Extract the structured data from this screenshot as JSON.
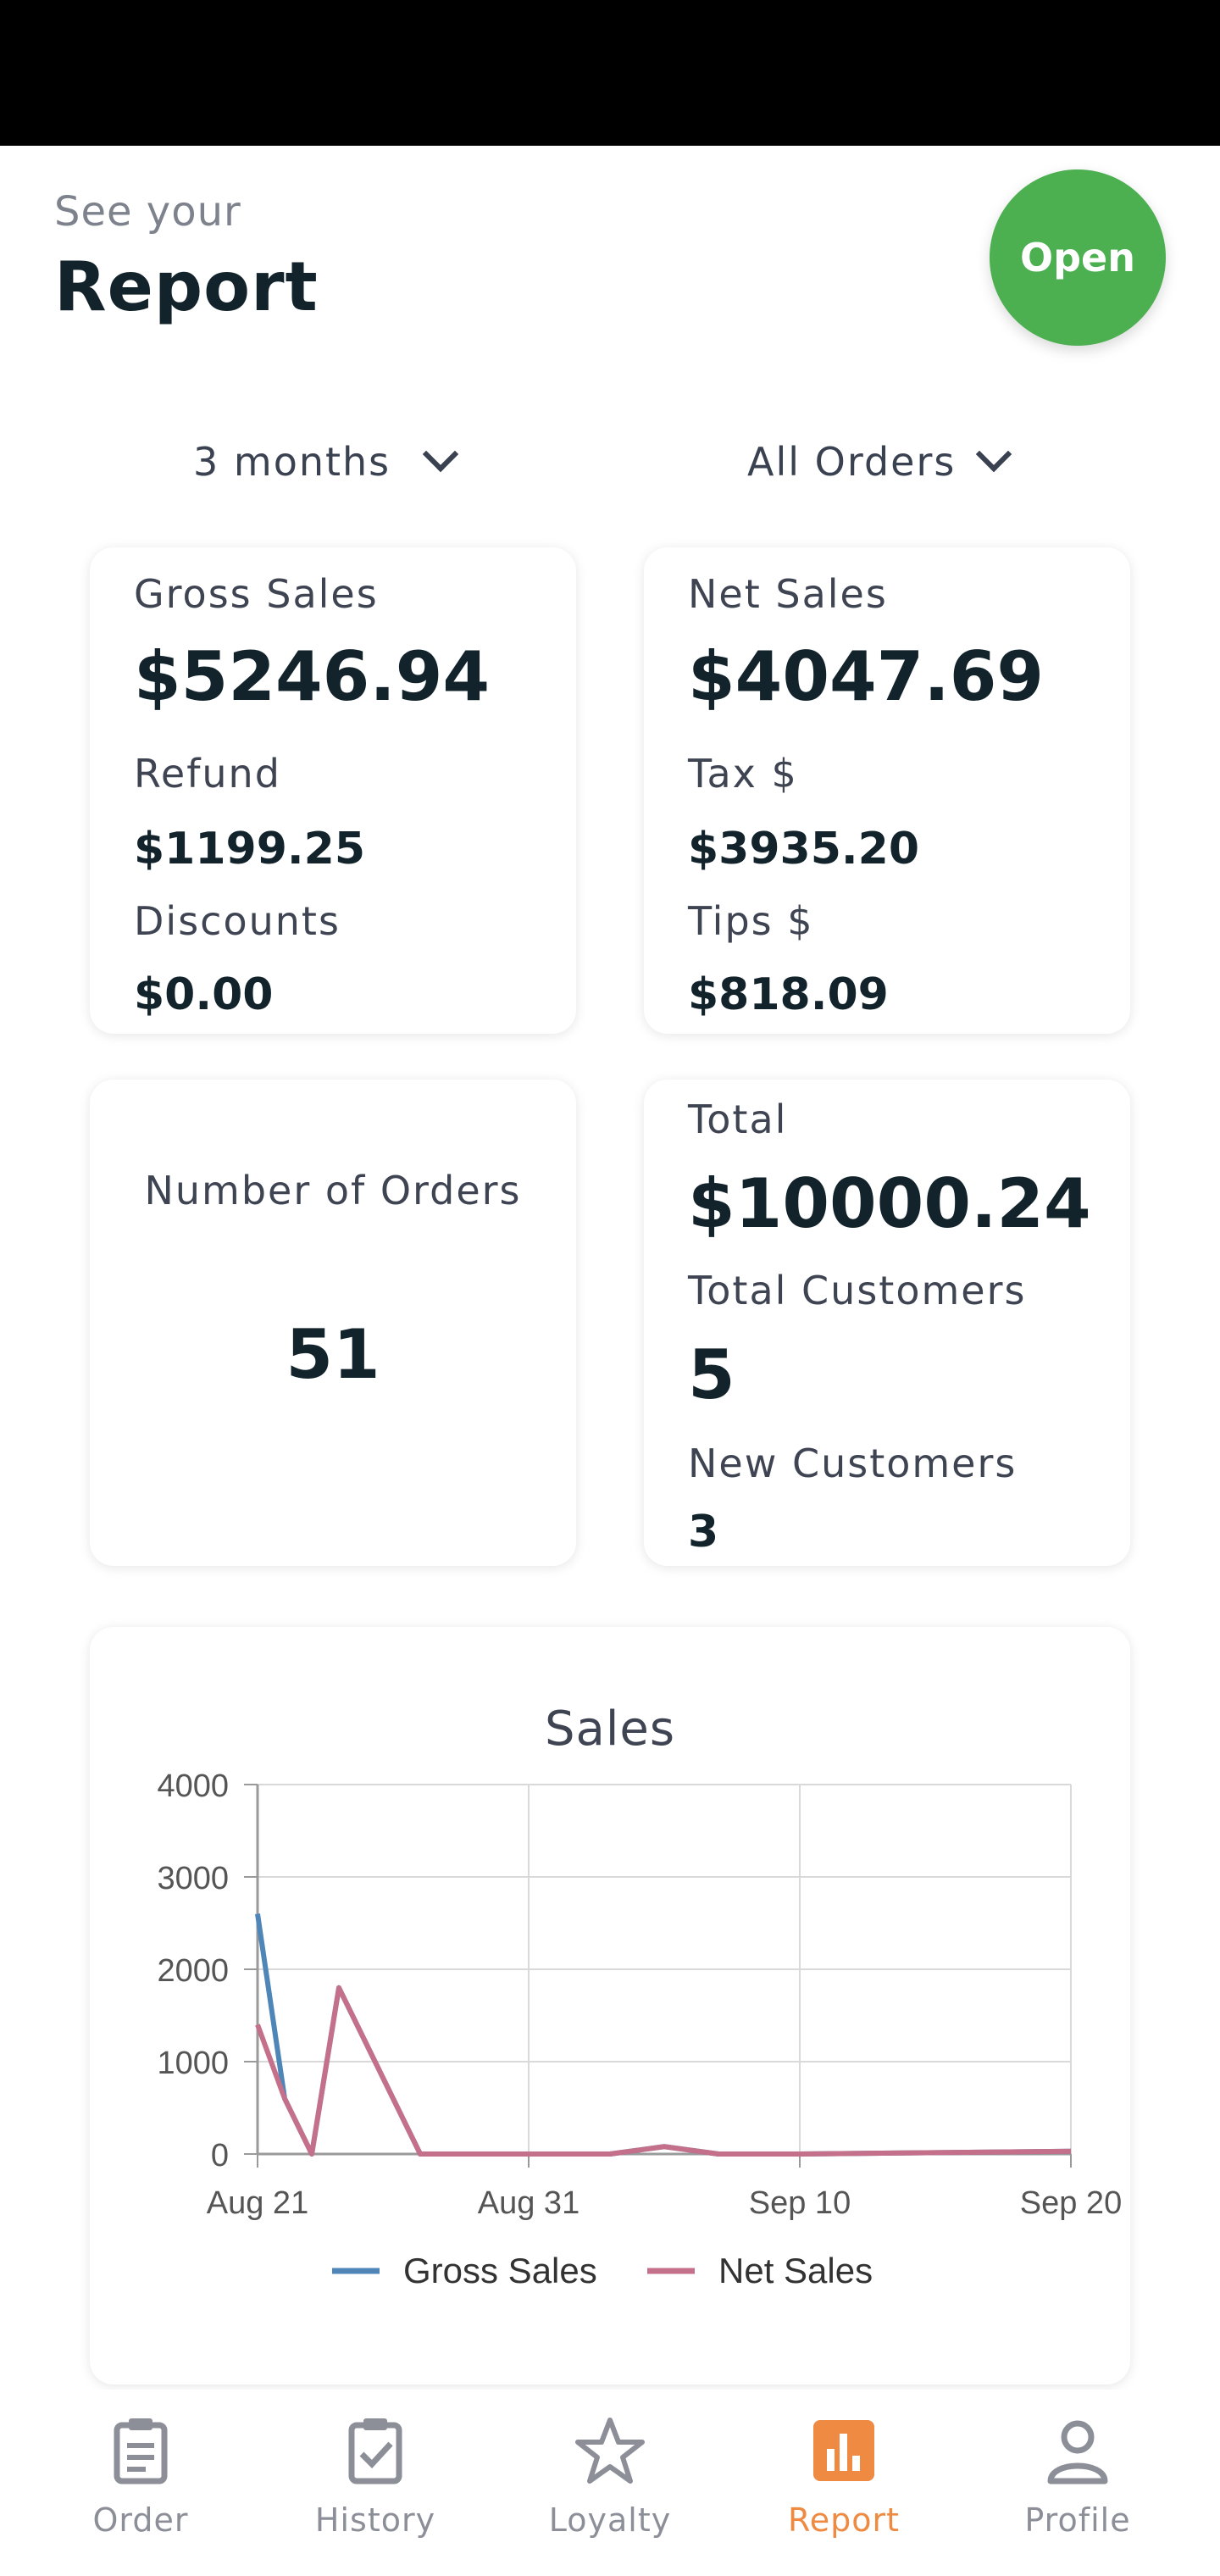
{
  "header": {
    "subtitle": "See your",
    "title": "Report",
    "status_button": "Open"
  },
  "filters": {
    "period": "3 months",
    "order_type": "All Orders"
  },
  "summary": {
    "gross_sales_label": "Gross Sales",
    "gross_sales": "$5246.94",
    "refund_label": "Refund",
    "refund": "$1199.25",
    "discounts_label": "Discounts",
    "discounts": "$0.00",
    "net_sales_label": "Net Sales",
    "net_sales": "$4047.69",
    "tax_label": "Tax $",
    "tax": "$3935.20",
    "tips_label": "Tips $",
    "tips": "$818.09",
    "orders_label": "Number of Orders",
    "orders": "51",
    "total_label": "Total",
    "total": "$10000.24",
    "total_customers_label": "Total Customers",
    "total_customers": "5",
    "new_customers_label": "New Customers",
    "new_customers": "3"
  },
  "colors": {
    "open_green": "#4caf50",
    "gross": "#4e86b8",
    "net": "#c4708a",
    "active_nav": "#ef8a43"
  },
  "chart_data": {
    "type": "line",
    "title": "Sales",
    "x_ticks": [
      "Aug 21",
      "Aug 31",
      "Sep 10",
      "Sep 20"
    ],
    "y_ticks": [
      "0",
      "1000",
      "2000",
      "3000",
      "4000"
    ],
    "ylim": [
      0,
      4000
    ],
    "xlim_days": [
      0,
      30
    ],
    "legend_position": "bottom",
    "grid": true,
    "series": [
      {
        "name": "Gross Sales",
        "color": "#4e86b8",
        "points": [
          [
            0,
            2600
          ],
          [
            1,
            600
          ],
          [
            2,
            0
          ],
          [
            3,
            1800
          ],
          [
            6,
            0
          ],
          [
            13,
            0
          ],
          [
            15,
            80
          ],
          [
            17,
            0
          ],
          [
            20,
            0
          ],
          [
            30,
            30
          ]
        ]
      },
      {
        "name": "Net Sales",
        "color": "#c4708a",
        "points": [
          [
            0,
            1400
          ],
          [
            1,
            600
          ],
          [
            2,
            0
          ],
          [
            3,
            1800
          ],
          [
            6,
            0
          ],
          [
            13,
            0
          ],
          [
            15,
            80
          ],
          [
            17,
            0
          ],
          [
            20,
            0
          ],
          [
            30,
            30
          ]
        ]
      }
    ]
  },
  "nav": [
    {
      "label": "Order",
      "icon": "clipboard-icon"
    },
    {
      "label": "History",
      "icon": "clipboard-check-icon"
    },
    {
      "label": "Loyalty",
      "icon": "star-icon"
    },
    {
      "label": "Report",
      "icon": "bar-chart-icon",
      "active": true
    },
    {
      "label": "Profile",
      "icon": "person-icon"
    }
  ]
}
